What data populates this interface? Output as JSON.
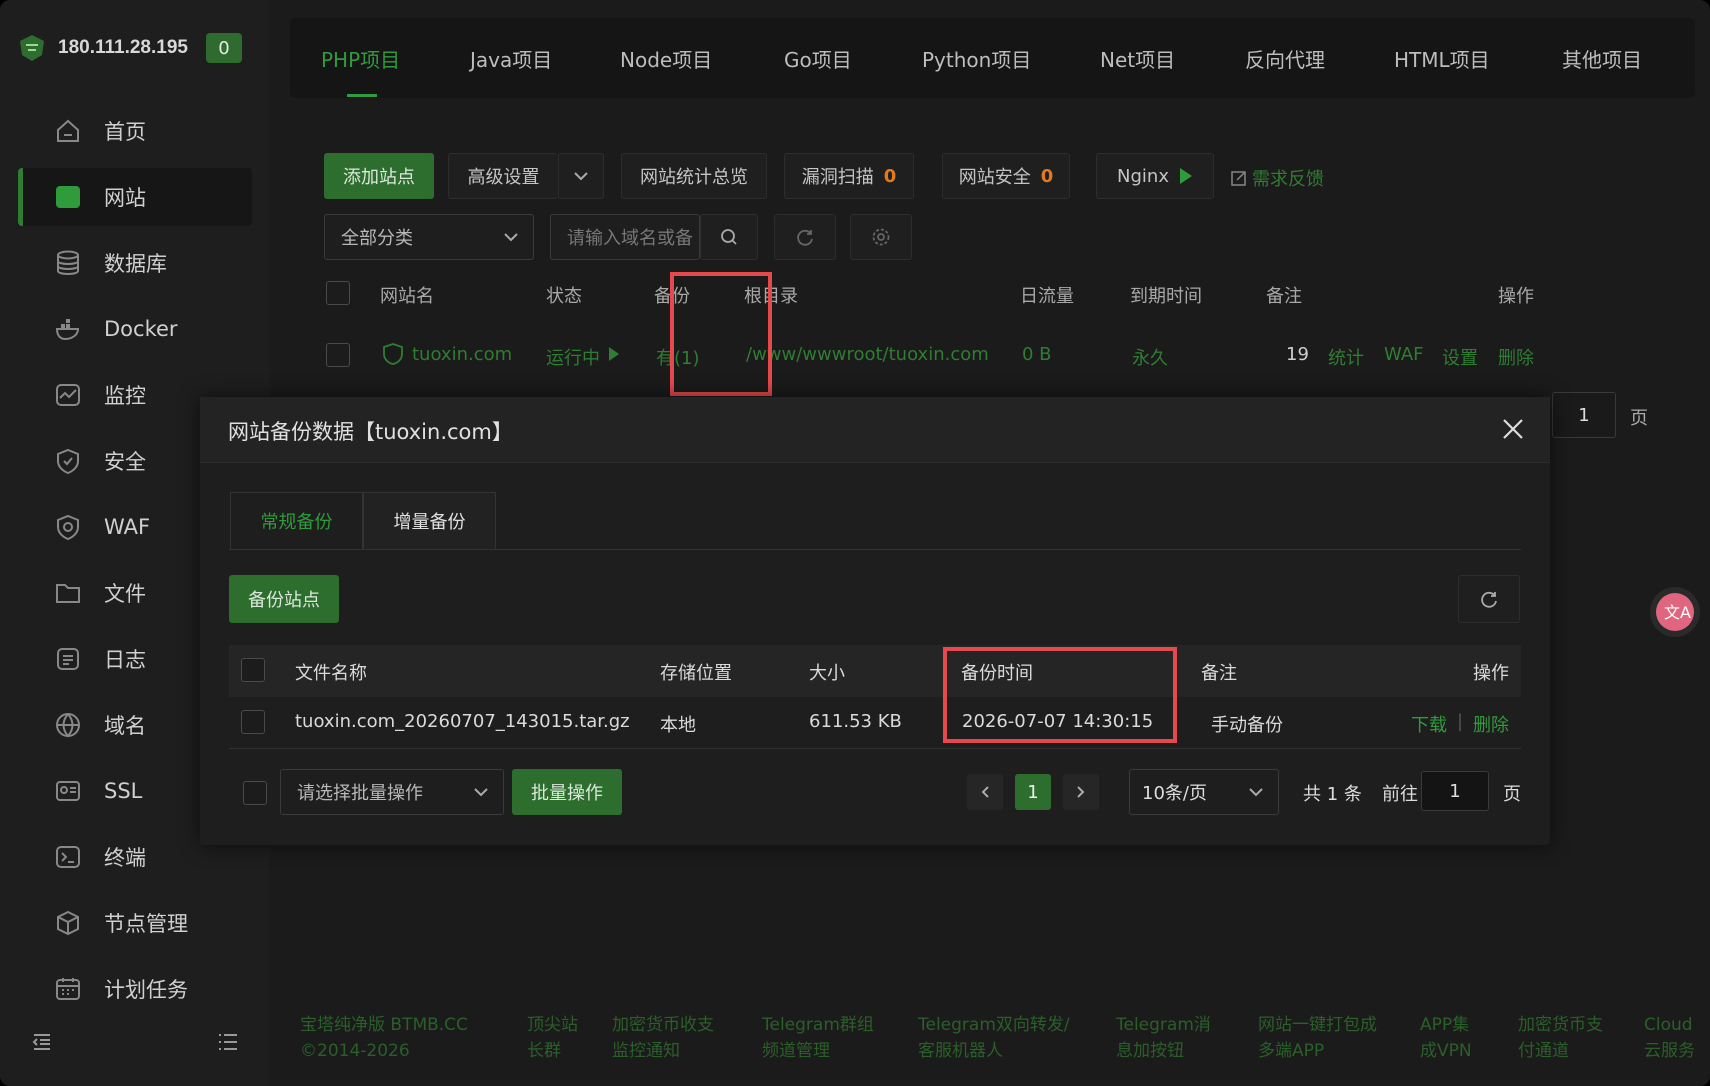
{
  "server": {
    "ip": "180.111.28.195",
    "badge": "0"
  },
  "sidebar": {
    "items": [
      {
        "label": "首页",
        "icon": "home-icon"
      },
      {
        "label": "网站",
        "icon": "website-icon",
        "active": true
      },
      {
        "label": "数据库",
        "icon": "database-icon"
      },
      {
        "label": "Docker",
        "icon": "docker-icon"
      },
      {
        "label": "监控",
        "icon": "monitor-icon"
      },
      {
        "label": "安全",
        "icon": "shield-icon"
      },
      {
        "label": "WAF",
        "icon": "waf-icon"
      },
      {
        "label": "文件",
        "icon": "folder-icon"
      },
      {
        "label": "日志",
        "icon": "log-icon"
      },
      {
        "label": "域名",
        "icon": "globe-icon"
      },
      {
        "label": "SSL",
        "icon": "ssl-icon"
      },
      {
        "label": "终端",
        "icon": "terminal-icon"
      },
      {
        "label": "节点管理",
        "icon": "node-icon"
      },
      {
        "label": "计划任务",
        "icon": "calendar-icon"
      }
    ]
  },
  "top_tabs": [
    "PHP项目",
    "Java项目",
    "Node项目",
    "Go项目",
    "Python项目",
    "Net项目",
    "反向代理",
    "HTML项目",
    "其他项目"
  ],
  "toolbar": {
    "add_site": "添加站点",
    "advanced": "高级设置",
    "stats": "网站统计总览",
    "vuln_scan": "漏洞扫描",
    "vuln_count": "0",
    "security": "网站安全",
    "security_count": "0",
    "nginx": "Nginx",
    "feedback": "需求反馈",
    "category": "全部分类",
    "search_placeholder": "请输入域名或备"
  },
  "site_table": {
    "headers": [
      "网站名",
      "状态",
      "备份",
      "根目录",
      "日流量",
      "到期时间",
      "备注",
      "操作"
    ],
    "row": {
      "name": "tuoxin.com",
      "status": "运行中",
      "backup": "有(1)",
      "root": "/www/wwwroot/tuoxin.com",
      "traffic": "0 B",
      "expire": "永久",
      "note": "19",
      "actions": [
        "统计",
        "WAF",
        "设置",
        "删除"
      ]
    },
    "page": "1",
    "page_suffix": "页"
  },
  "modal": {
    "title": "网站备份数据【tuoxin.com】",
    "tabs": [
      "常规备份",
      "增量备份"
    ],
    "backup_button": "备份站点",
    "headers": [
      "文件名称",
      "存储位置",
      "大小",
      "备份时间",
      "备注",
      "操作"
    ],
    "row": {
      "filename": "tuoxin.com_20260707_143015.tar.gz",
      "location": "本地",
      "size": "611.53 KB",
      "time": "2026-07-07 14:30:15",
      "note": "手动备份",
      "download": "下载",
      "delete": "删除"
    },
    "batch_placeholder": "请选择批量操作",
    "batch_button": "批量操作",
    "current_page": "1",
    "per_page": "10条/页",
    "total": "共 1 条",
    "goto": "前往",
    "goto_value": "1",
    "page_suffix": "页"
  },
  "footer": [
    [
      "宝塔纯净版 BTMB.CC",
      "©2014-2026"
    ],
    [
      "顶尖站",
      "长群"
    ],
    [
      "加密货币收支",
      "监控通知"
    ],
    [
      "Telegram群组",
      "频道管理"
    ],
    [
      "Telegram双向转发/",
      "客服机器人"
    ],
    [
      "Telegram消",
      "息加按钮"
    ],
    [
      "网站一键打包成",
      "多端APP"
    ],
    [
      "APP集",
      "成VPN"
    ],
    [
      "加密货币支",
      "付通道"
    ],
    [
      "Cloud",
      "云服务"
    ]
  ],
  "colors": {
    "accent": "#2f7d32",
    "highlight": "#e6494b",
    "warning": "#e07a1f"
  }
}
